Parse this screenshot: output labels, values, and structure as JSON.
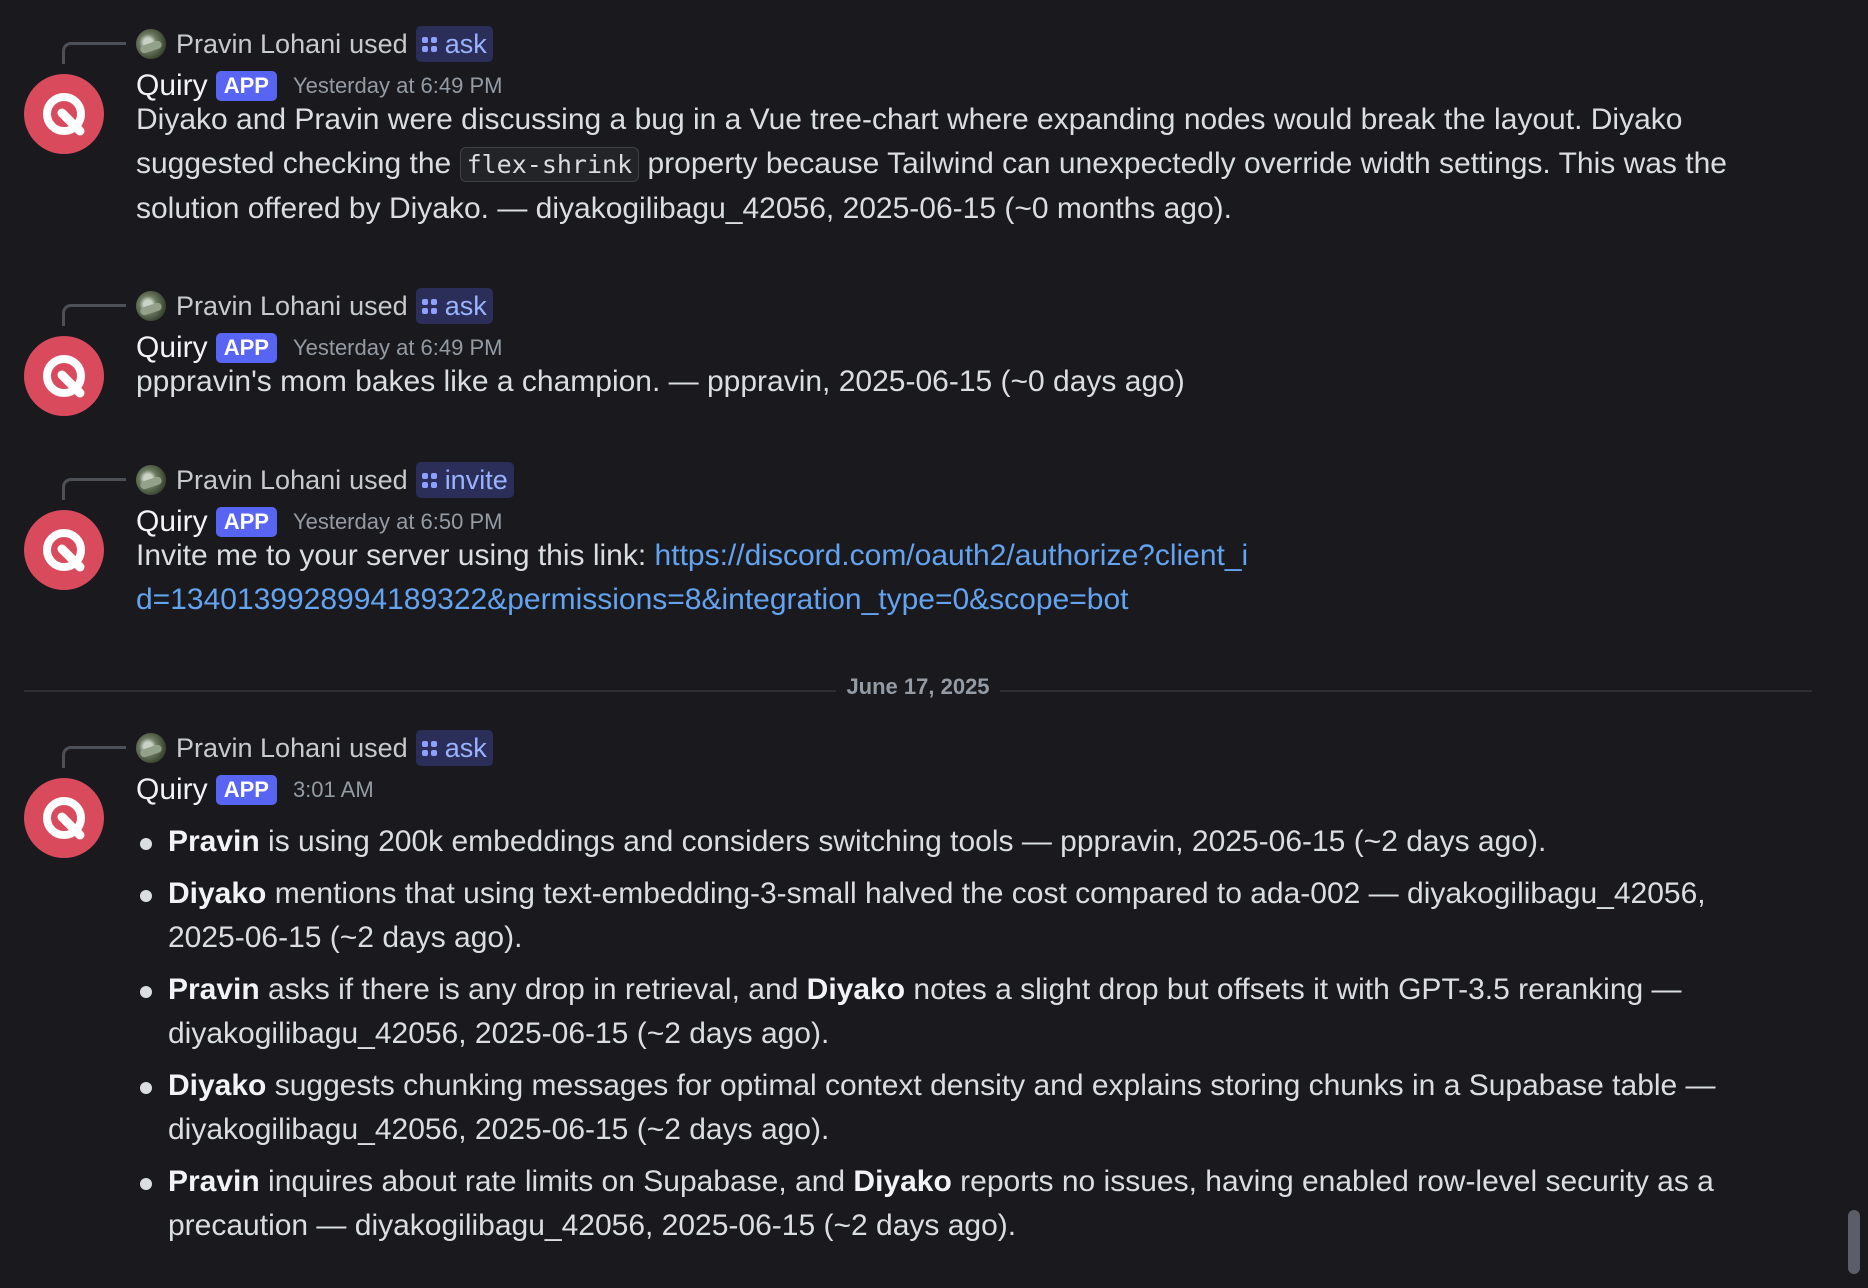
{
  "messages": [
    {
      "invoker": "Pravin Lohani",
      "used": "used",
      "command": "ask",
      "bot": "Quiry",
      "tag": "APP",
      "time": "Yesterday at 6:49 PM",
      "text_parts": {
        "p1": "Diyako and Pravin were discussing a bug in a Vue tree-chart where expanding nodes would break the layout. Diyako suggested checking the ",
        "code": "flex-shrink",
        "p2": " property because Tailwind can unexpectedly override width settings. This was the solution offered by Diyako. — diyakogilibagu_42056, 2025-06-15 (~0 months ago)."
      }
    },
    {
      "invoker": "Pravin Lohani",
      "used": "used",
      "command": "ask",
      "bot": "Quiry",
      "tag": "APP",
      "time": "Yesterday at 6:49 PM",
      "text": "pppravin's mom bakes like a champion. — pppravin, 2025-06-15 (~0 days ago)"
    },
    {
      "invoker": "Pravin Lohani",
      "used": "used",
      "command": "invite",
      "bot": "Quiry",
      "tag": "APP",
      "time": "Yesterday at 6:50 PM",
      "text": "Invite me to your server using this link: ",
      "link": "https://discord.com/oauth2/authorize?client_id=1340139928994189322&permissions=8&integration_type=0&scope=bot"
    },
    {
      "invoker": "Pravin Lohani",
      "used": "used",
      "command": "ask",
      "bot": "Quiry",
      "tag": "APP",
      "time": "3:01 AM",
      "bullets": [
        {
          "b1": "Pravin",
          "t1": " is using 200k embeddings and considers switching tools — pppravin, 2025-06-15 (~2 days ago)."
        },
        {
          "b1": "Diyako",
          "t1": " mentions that using text-embedding-3-small halved the cost compared to ada-002 — diyakogilibagu_42056, 2025-06-15 (~2 days ago)."
        },
        {
          "b1": "Pravin",
          "t1": " asks if there is any drop in retrieval, and ",
          "b2": "Diyako",
          "t2": " notes a slight drop but offsets it with GPT-3.5 reranking — diyakogilibagu_42056, 2025-06-15 (~2 days ago)."
        },
        {
          "b1": "Diyako",
          "t1": " suggests chunking messages for optimal context density and explains storing chunks in a Supabase table — diyakogilibagu_42056, 2025-06-15 (~2 days ago)."
        },
        {
          "b1": "Pravin",
          "t1": " inquires about rate limits on Supabase, and ",
          "b2": "Diyako",
          "t2": " reports no issues, having enabled row-level security as a precaution — diyakogilibagu_42056, 2025-06-15 (~2 days ago)."
        }
      ]
    }
  ],
  "divider": {
    "date": "June 17, 2025"
  },
  "colors": {
    "background": "#1a1a1e",
    "avatar": "#d94a5c",
    "app_tag": "#5865f2",
    "link": "#63a3f0"
  },
  "icons": {
    "bot_avatar": "quiry-logo-icon",
    "command": "slash-command-icon"
  }
}
